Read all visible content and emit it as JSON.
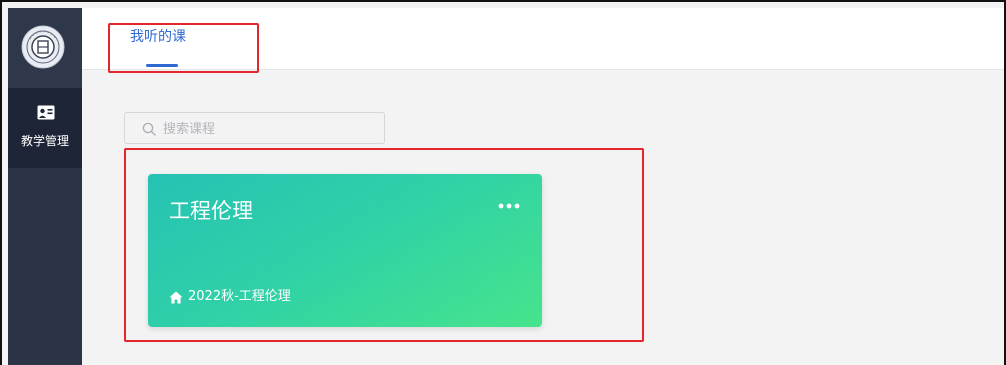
{
  "sidebar": {
    "logo_icon": "university-seal-icon",
    "items": [
      {
        "icon": "teaching-board-icon",
        "label": "教学管理"
      }
    ]
  },
  "header": {
    "tabs": [
      {
        "label": "我听的课",
        "active": true
      }
    ]
  },
  "search": {
    "placeholder": "搜索课程",
    "value": ""
  },
  "courses": [
    {
      "title": "工程伦理",
      "class_name": "2022秋-工程伦理",
      "menu_icon": "more-dots-icon"
    }
  ],
  "colors": {
    "sidebar_bg": "#2b3347",
    "accent": "#2f6ad3",
    "highlight_box": "#e2262b",
    "card_gradient_start": "#26c2b4",
    "card_gradient_end": "#46e48c"
  }
}
